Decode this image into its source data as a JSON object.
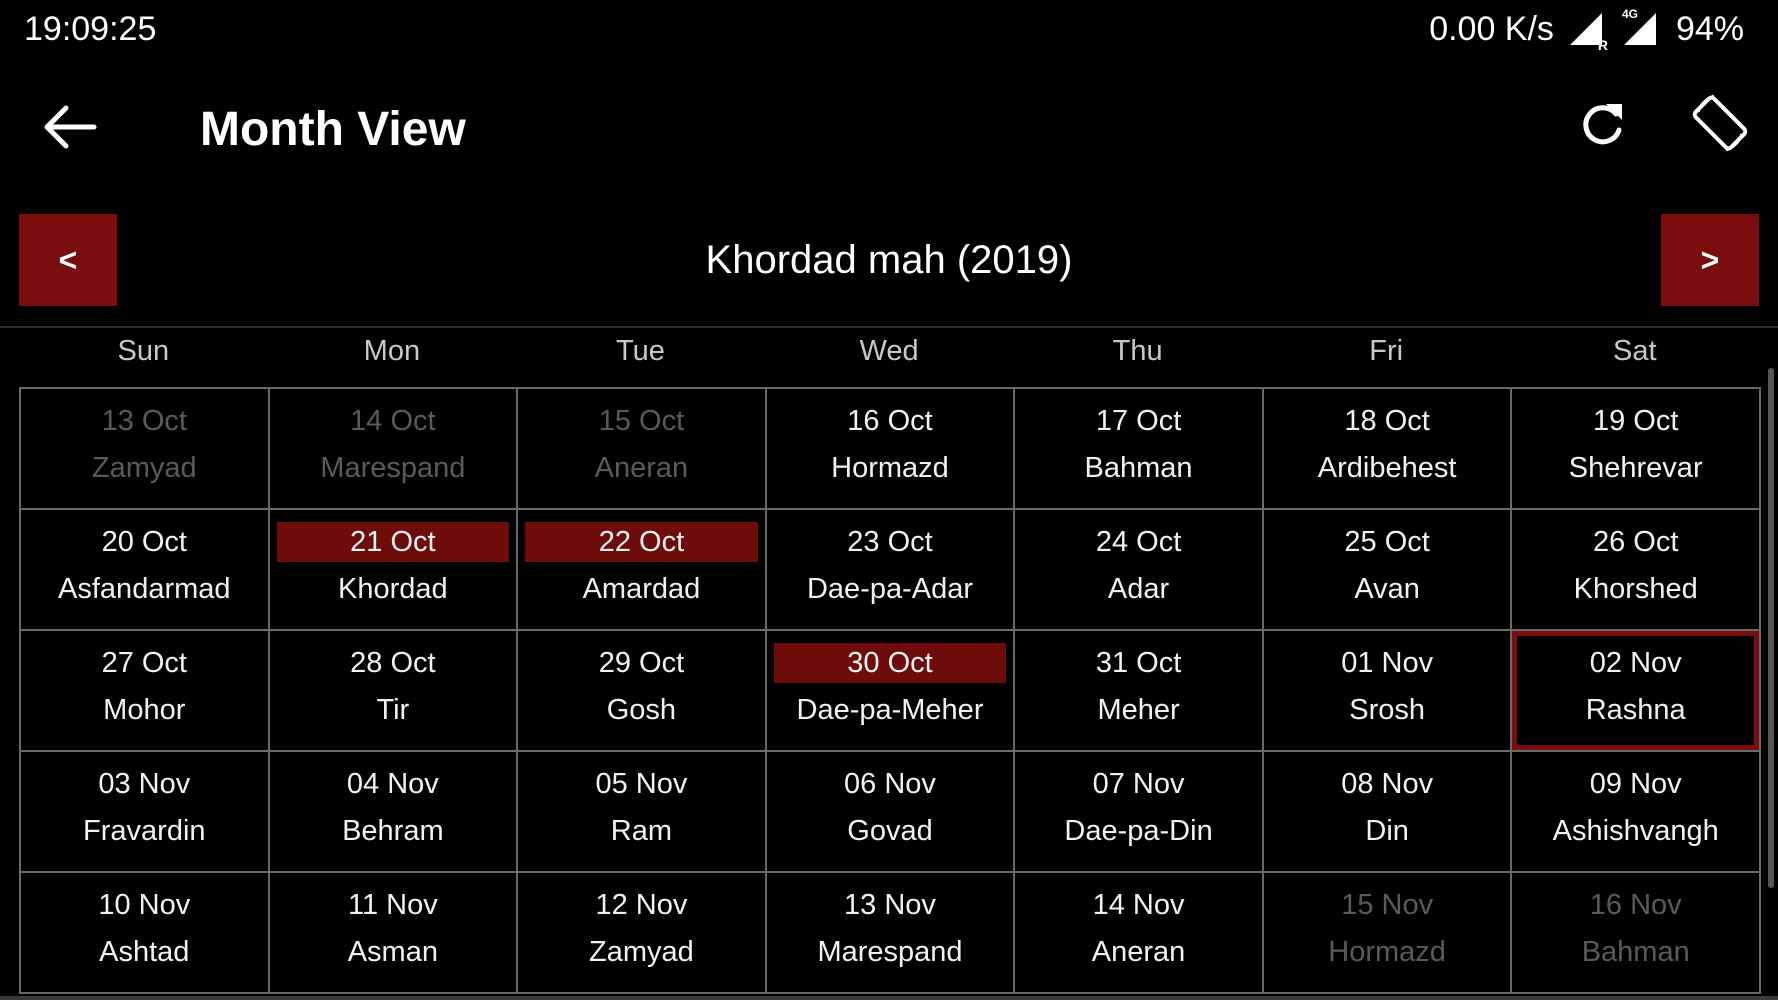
{
  "status": {
    "time": "19:09:25",
    "speed": "0.00 K/s",
    "network": "4G",
    "roaming": "R",
    "battery": "94%"
  },
  "appbar": {
    "title": "Month View",
    "icons": [
      "back-arrow-icon",
      "refresh-icon",
      "screen-rotation-icon"
    ]
  },
  "nav": {
    "prev_label": "<",
    "next_label": ">",
    "month_title": "Khordad mah (2019)"
  },
  "weekdays": [
    "Sun",
    "Mon",
    "Tue",
    "Wed",
    "Thu",
    "Fri",
    "Sat"
  ],
  "colors": {
    "accent": "#7a0e0e",
    "highlight": "#6e0c0c",
    "muted_text": "#5a5a5a"
  },
  "days": [
    {
      "date": "13 Oct",
      "name": "Zamyad",
      "muted": true
    },
    {
      "date": "14 Oct",
      "name": "Marespand",
      "muted": true
    },
    {
      "date": "15 Oct",
      "name": "Aneran",
      "muted": true
    },
    {
      "date": "16 Oct",
      "name": "Hormazd"
    },
    {
      "date": "17 Oct",
      "name": "Bahman"
    },
    {
      "date": "18 Oct",
      "name": "Ardibehest"
    },
    {
      "date": "19 Oct",
      "name": "Shehrevar"
    },
    {
      "date": "20 Oct",
      "name": "Asfandarmad"
    },
    {
      "date": "21 Oct",
      "name": "Khordad",
      "highlighted": true
    },
    {
      "date": "22 Oct",
      "name": "Amardad",
      "highlighted": true
    },
    {
      "date": "23 Oct",
      "name": "Dae-pa-Adar"
    },
    {
      "date": "24 Oct",
      "name": "Adar"
    },
    {
      "date": "25 Oct",
      "name": "Avan"
    },
    {
      "date": "26 Oct",
      "name": "Khorshed"
    },
    {
      "date": "27 Oct",
      "name": "Mohor"
    },
    {
      "date": "28 Oct",
      "name": "Tir"
    },
    {
      "date": "29 Oct",
      "name": "Gosh"
    },
    {
      "date": "30 Oct",
      "name": "Dae-pa-Meher",
      "highlighted": true
    },
    {
      "date": "31 Oct",
      "name": "Meher"
    },
    {
      "date": "01 Nov",
      "name": "Srosh"
    },
    {
      "date": "02 Nov",
      "name": "Rashna",
      "today": true
    },
    {
      "date": "03 Nov",
      "name": "Fravardin"
    },
    {
      "date": "04 Nov",
      "name": "Behram"
    },
    {
      "date": "05 Nov",
      "name": "Ram"
    },
    {
      "date": "06 Nov",
      "name": "Govad"
    },
    {
      "date": "07 Nov",
      "name": "Dae-pa-Din"
    },
    {
      "date": "08 Nov",
      "name": "Din"
    },
    {
      "date": "09 Nov",
      "name": "Ashishvangh"
    },
    {
      "date": "10 Nov",
      "name": "Ashtad"
    },
    {
      "date": "11 Nov",
      "name": "Asman"
    },
    {
      "date": "12 Nov",
      "name": "Zamyad"
    },
    {
      "date": "13 Nov",
      "name": "Marespand"
    },
    {
      "date": "14 Nov",
      "name": "Aneran"
    },
    {
      "date": "15 Nov",
      "name": "Hormazd",
      "muted": true
    },
    {
      "date": "16 Nov",
      "name": "Bahman",
      "muted": true
    }
  ]
}
